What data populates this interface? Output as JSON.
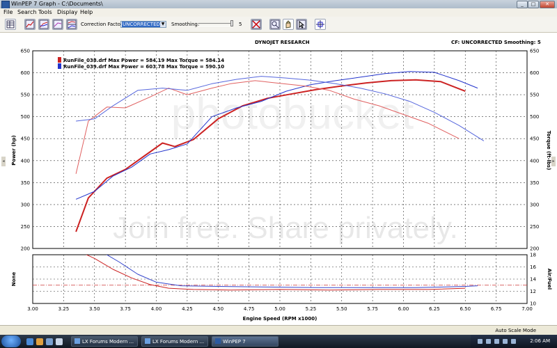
{
  "window": {
    "title": "WinPEP 7    Graph - C:\\Documents\\",
    "minimize": "_",
    "maximize": "□",
    "close": "✕"
  },
  "menu": [
    "File",
    "Search",
    "Tools",
    "Display",
    "Help"
  ],
  "toolbar": {
    "correction_label": "Correction Factor:",
    "correction_value": "UNCORRECTED",
    "smoothing_label": "Smoothing:",
    "smoothing_value": "5",
    "icons": [
      "table-icon",
      "graph-icon",
      "multi-graph-icon",
      "graph-options-icon",
      "graph-stack-icon",
      "disabled-x-icon",
      "chart-zoom-icon",
      "hand-icon",
      "cursor-icon",
      "crosshair-icon"
    ]
  },
  "graph_header": {
    "center": "DYNOJET RESEARCH",
    "right": "CF: UNCORRECTED   Smoothing: 5"
  },
  "watermark": {
    "line1": "photobucket",
    "line2": "Join free. Share privately."
  },
  "statusbar": {
    "text": "Auto Scale Mode"
  },
  "taskbar": {
    "tasks": [
      "LX Forums Modern ...",
      "LX Forums Modern ...",
      "WinPEP 7"
    ],
    "clock": "2:06 AM"
  },
  "colors": {
    "run1": "#cc2222",
    "run2": "#2233cc",
    "af_ref": "#cc3333"
  },
  "chart_data": {
    "type": "line",
    "main": {
      "xlabel": "Engine Speed (RPM x1000)",
      "ylabel_left": "Power (hp)",
      "ylabel_right": "Torque (ft-lbs)",
      "xlim": [
        3.0,
        7.0
      ],
      "ylim": [
        200,
        650
      ],
      "x_ticks": [
        "3.00",
        "3.25",
        "3.50",
        "3.75",
        "4.00",
        "4.25",
        "4.50",
        "4.75",
        "5.00",
        "5.25",
        "5.50",
        "5.75",
        "6.00",
        "6.25",
        "6.50",
        "6.75",
        "7.00"
      ],
      "y_ticks": [
        "650",
        "600",
        "550",
        "500",
        "450",
        "400",
        "350",
        "300",
        "250",
        "200"
      ],
      "legend": [
        {
          "text": "RunFile_038.drf Max Power = 584.19 Max Torque = 584.14",
          "color": "#cc2222"
        },
        {
          "text": "RunFile_039.drf Max Power = 603.78 Max Torque = 590.10",
          "color": "#2233cc"
        }
      ],
      "series": [
        {
          "name": "RunFile_038.drf Power",
          "color": "#cc2222",
          "width": 2,
          "x": [
            3.35,
            3.45,
            3.6,
            3.75,
            3.9,
            4.05,
            4.15,
            4.3,
            4.5,
            4.7,
            4.9,
            5.1,
            5.3,
            5.5,
            5.7,
            5.9,
            6.1,
            6.3,
            6.5
          ],
          "y": [
            238,
            315,
            360,
            380,
            410,
            440,
            432,
            448,
            495,
            525,
            542,
            552,
            562,
            570,
            577,
            582,
            584,
            580,
            558
          ]
        },
        {
          "name": "RunFile_039.drf Power",
          "color": "#2233cc",
          "width": 1,
          "x": [
            3.35,
            3.5,
            3.65,
            3.8,
            3.95,
            4.1,
            4.25,
            4.45,
            4.65,
            4.85,
            5.05,
            5.25,
            5.45,
            5.65,
            5.85,
            6.05,
            6.25,
            6.45,
            6.6
          ],
          "y": [
            312,
            330,
            365,
            385,
            415,
            425,
            438,
            500,
            520,
            535,
            558,
            573,
            582,
            590,
            598,
            603,
            601,
            582,
            565
          ]
        },
        {
          "name": "RunFile_038.drf Torque",
          "color": "#e06060",
          "width": 1,
          "x": [
            3.35,
            3.45,
            3.6,
            3.75,
            3.95,
            4.1,
            4.25,
            4.45,
            4.6,
            4.8,
            5.0,
            5.2,
            5.4,
            5.6,
            5.8,
            6.0,
            6.2,
            6.45
          ],
          "y": [
            370,
            490,
            522,
            520,
            545,
            565,
            550,
            565,
            575,
            582,
            576,
            570,
            560,
            540,
            525,
            505,
            485,
            450
          ]
        },
        {
          "name": "RunFile_039.drf Torque",
          "color": "#5566dd",
          "width": 1,
          "x": [
            3.35,
            3.5,
            3.65,
            3.85,
            4.05,
            4.25,
            4.45,
            4.65,
            4.85,
            5.05,
            5.25,
            5.45,
            5.65,
            5.85,
            6.05,
            6.25,
            6.45,
            6.65
          ],
          "y": [
            490,
            495,
            525,
            560,
            565,
            560,
            575,
            585,
            592,
            588,
            583,
            575,
            565,
            552,
            535,
            510,
            480,
            445
          ]
        }
      ]
    },
    "af": {
      "ylabel_left": "None",
      "ylabel_right": "Air/Fuel",
      "ylim": [
        10,
        18
      ],
      "y_ticks": [
        "18",
        "16",
        "14",
        "12",
        "10"
      ],
      "reference": 13.0,
      "series": [
        {
          "name": "RunFile_038.drf Air/Fuel",
          "color": "#cc2222",
          "x": [
            3.35,
            3.5,
            3.65,
            3.8,
            3.95,
            4.1,
            4.3,
            4.6,
            5.0,
            5.4,
            5.8,
            6.2,
            6.5
          ],
          "y": [
            18.8,
            17.4,
            15.6,
            14.2,
            13.1,
            12.5,
            12.3,
            12.2,
            12.3,
            12.2,
            12.3,
            12.3,
            12.5
          ]
        },
        {
          "name": "RunFile_039.drf Air/Fuel",
          "color": "#3344cc",
          "x": [
            3.35,
            3.55,
            3.7,
            3.85,
            4.0,
            4.2,
            4.5,
            4.9,
            5.3,
            5.7,
            6.1,
            6.5,
            6.6
          ],
          "y": [
            19.0,
            18.6,
            16.8,
            14.8,
            13.5,
            12.9,
            12.8,
            12.7,
            12.6,
            12.6,
            12.6,
            12.8,
            12.9
          ]
        }
      ]
    }
  }
}
